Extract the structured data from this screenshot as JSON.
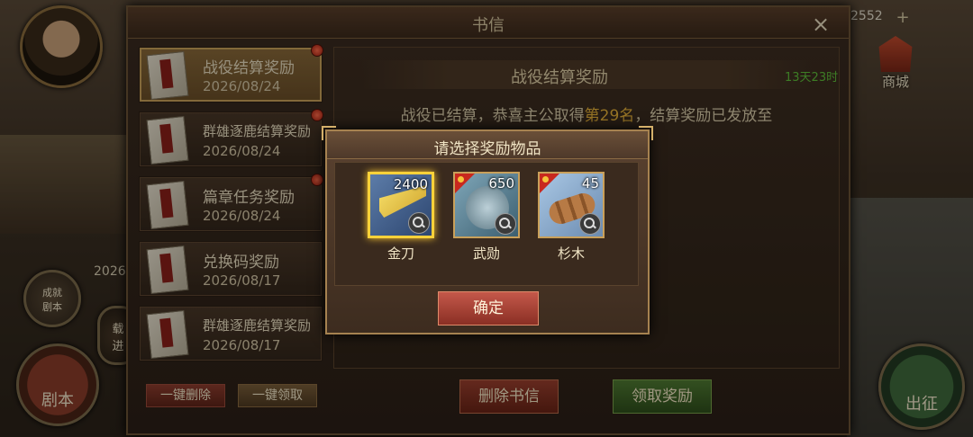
{
  "hud": {
    "resource_count": "2552",
    "resource_plus": "+",
    "shop_label": "商城",
    "juben_label": "剧本",
    "chuzheng_label": "出征",
    "small_btn_1": "成就\n剧本",
    "small_btn_2": "载\n进",
    "year_left": "2026"
  },
  "mail_window": {
    "title": "书信",
    "close": "×",
    "items": [
      {
        "subject": "战役结算奖励",
        "date": "2026/08/24",
        "unread": true,
        "active": true
      },
      {
        "subject": "群雄逐鹿结算奖励",
        "date": "2026/08/24",
        "unread": true,
        "active": false
      },
      {
        "subject": "篇章任务奖励",
        "date": "2026/08/24",
        "unread": true,
        "active": false
      },
      {
        "subject": "兑换码奖励",
        "date": "2026/08/17",
        "unread": false,
        "active": false
      },
      {
        "subject": "群雄逐鹿结算奖励",
        "date": "2026/08/17",
        "unread": false,
        "active": false
      }
    ],
    "delete_all_label": "一键删除",
    "claim_all_label": "一键领取",
    "content": {
      "title": "战役结算奖励",
      "expire": "13天23时",
      "body_prefix": "战役已结算，恭喜主公取得",
      "body_rank": "第29名",
      "body_suffix": "，结算奖励已发放至"
    },
    "delete_mail_label": "删除书信",
    "claim_label": "领取奖励"
  },
  "reward_dialog": {
    "title": "请选择奖励物品",
    "items": [
      {
        "name": "金刀",
        "qty": "2400",
        "selected": true,
        "icon": "gold-blade-icon"
      },
      {
        "name": "武勋",
        "qty": "650",
        "selected": false,
        "icon": "medal-icon"
      },
      {
        "name": "杉木",
        "qty": "45",
        "selected": false,
        "icon": "wood-log-icon"
      }
    ],
    "confirm_label": "确定"
  }
}
